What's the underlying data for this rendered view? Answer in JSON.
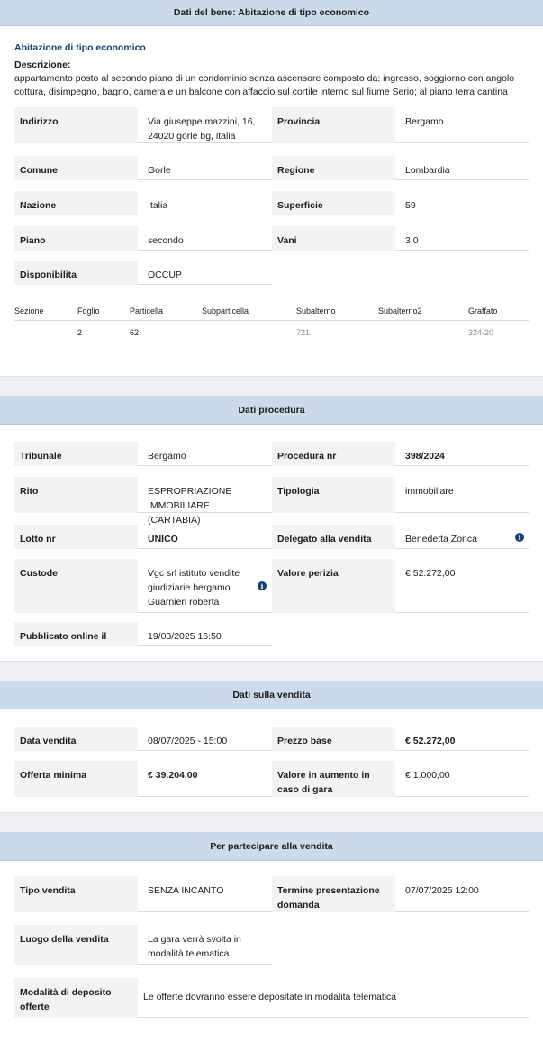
{
  "bene": {
    "header": "Dati del bene: Abitazione di tipo economico",
    "subtitle": "Abitazione di tipo economico",
    "desc_label": "Descrizione:",
    "desc_text": "appartamento posto al secondo piano di un condominio senza ascensore composto da: ingresso, soggiorno con angolo cottura, disimpegno, bagno, camera e un balcone con affaccio sul cortile interno sul fiume Serio; al piano terra cantina",
    "fields": {
      "indirizzo_label": "Indirizzo",
      "indirizzo_value": "Via giuseppe mazzini, 16, 24020 gorle bg, italia",
      "provincia_label": "Provincia",
      "provincia_value": "Bergamo",
      "comune_label": "Comune",
      "comune_value": "Gorle",
      "regione_label": "Regione",
      "regione_value": "Lombardia",
      "nazione_label": "Nazione",
      "nazione_value": "Italia",
      "superficie_label": "Superficie",
      "superficie_value": "59",
      "piano_label": "Piano",
      "piano_value": "secondo",
      "vani_label": "Vani",
      "vani_value": "3.0",
      "disponibilita_label": "Disponibilita",
      "disponibilita_value": "OCCUP"
    },
    "catasto": {
      "headers": [
        "Sezione",
        "Foglio",
        "Particella",
        "Subparticella",
        "Subalterno",
        "Subalterno2",
        "Graffato"
      ],
      "row": [
        "",
        "2",
        "62",
        "",
        "721",
        "",
        "324-20"
      ]
    }
  },
  "procedura": {
    "header": "Dati procedura",
    "tribunale_label": "Tribunale",
    "tribunale_value": "Bergamo",
    "procedura_label": "Procedura nr",
    "procedura_value": "398/2024",
    "rito_label": "Rito",
    "rito_value": "ESPROPRIAZIONE IMMOBILIARE (CARTABIA)",
    "tipologia_label": "Tipologia",
    "tipologia_value": "immobiliare",
    "lotto_label": "Lotto nr",
    "lotto_value": "UNICO",
    "delegato_label": "Delegato alla vendita",
    "delegato_value": "Benedetta Zonca",
    "custode_label": "Custode",
    "custode_value": "Vgc srl istituto vendite giudiziarie bergamo Guarnieri roberta",
    "perizia_label": "Valore perizia",
    "perizia_value": "€ 52.272,00",
    "pubblicato_label": "Pubblicato online il",
    "pubblicato_value": "19/03/2025 16:50"
  },
  "vendita": {
    "header": "Dati sulla vendita",
    "data_label": "Data vendita",
    "data_value": "08/07/2025 - 15:00",
    "prezzo_label": "Prezzo base",
    "prezzo_value": "€ 52.272,00",
    "offerta_label": "Offerta minima",
    "offerta_value": "€ 39.204,00",
    "aumento_label": "Valore in aumento in caso di gara",
    "aumento_value": "€ 1.000,00"
  },
  "partecipare": {
    "header": "Per partecipare alla vendita",
    "tipo_label": "Tipo vendita",
    "tipo_value": "SENZA INCANTO",
    "termine_label": "Termine presentazione domanda",
    "termine_value": "07/07/2025 12:00",
    "luogo_label": "Luogo della vendita",
    "luogo_value": "La gara verrà svolta in modalità telematica",
    "deposito_label": "Modalità di deposito offerte",
    "deposito_value": "Le offerte dovranno essere depositate in modalità telematica"
  },
  "icons": {
    "info": "info-icon"
  },
  "colors": {
    "header_bg": "#ccdbeb",
    "accent": "#17406f",
    "label_bg": "#f2f3f5"
  }
}
